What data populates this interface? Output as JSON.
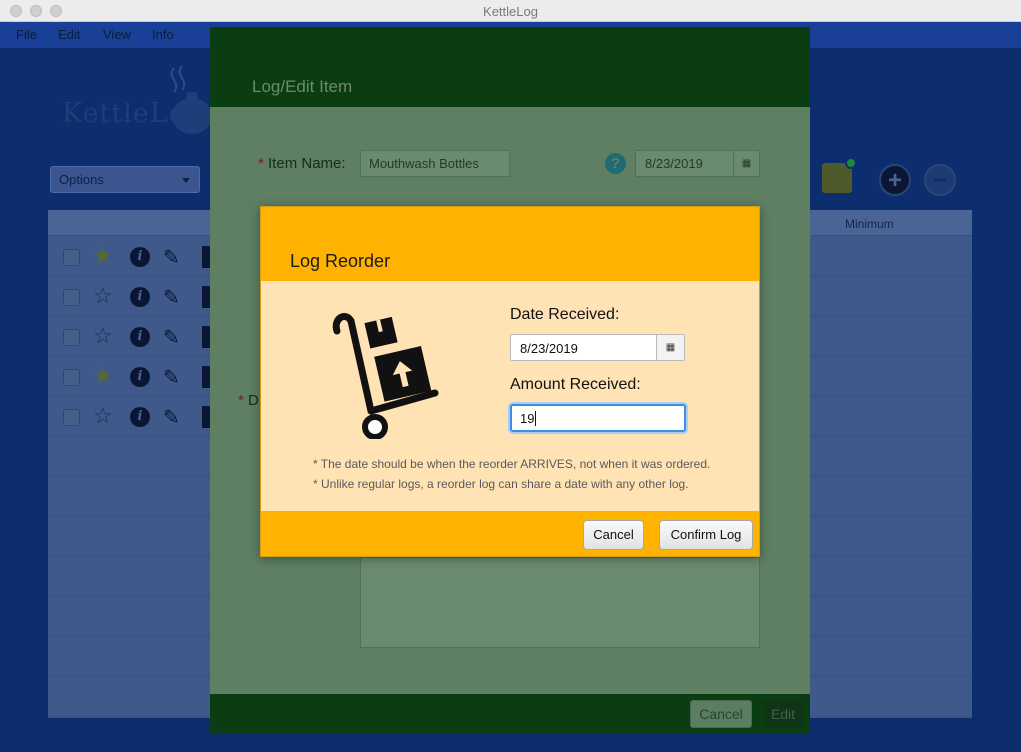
{
  "window": {
    "title": "KettleLog"
  },
  "menu": [
    "File",
    "Edit",
    "View",
    "Info"
  ],
  "app": {
    "logo_text": "KettleLog",
    "options_label": "Options",
    "table": {
      "column_minimum": "Minimum"
    },
    "rows": [
      {
        "starred": true
      },
      {
        "starred": false
      },
      {
        "starred": false
      },
      {
        "starred": true
      },
      {
        "starred": false
      }
    ],
    "icons": {
      "add": "plus-circle-icon",
      "remove": "minus-circle-icon",
      "checklist": "checkbox-badge-icon"
    }
  },
  "edit_dialog": {
    "title": "Log/Edit Item",
    "item_name_label": "Item Name:",
    "item_name_value": "Mouthwash Bottles",
    "date_value": "8/23/2019",
    "partial_label": "D",
    "cancel_label": "Cancel",
    "edit_label": "Edit"
  },
  "reorder_dialog": {
    "title": "Log Reorder",
    "date_received_label": "Date Received:",
    "date_received_value": "8/23/2019",
    "amount_received_label": "Amount Received:",
    "amount_received_value": "19",
    "note1": "* The date should be when the reorder ARRIVES, not when it was ordered.",
    "note2": "* Unlike regular logs, a reorder log can share a date with any other log.",
    "cancel_label": "Cancel",
    "confirm_label": "Confirm Log",
    "colors": {
      "header": "#ffb300",
      "body": "#ffe3b5"
    }
  }
}
